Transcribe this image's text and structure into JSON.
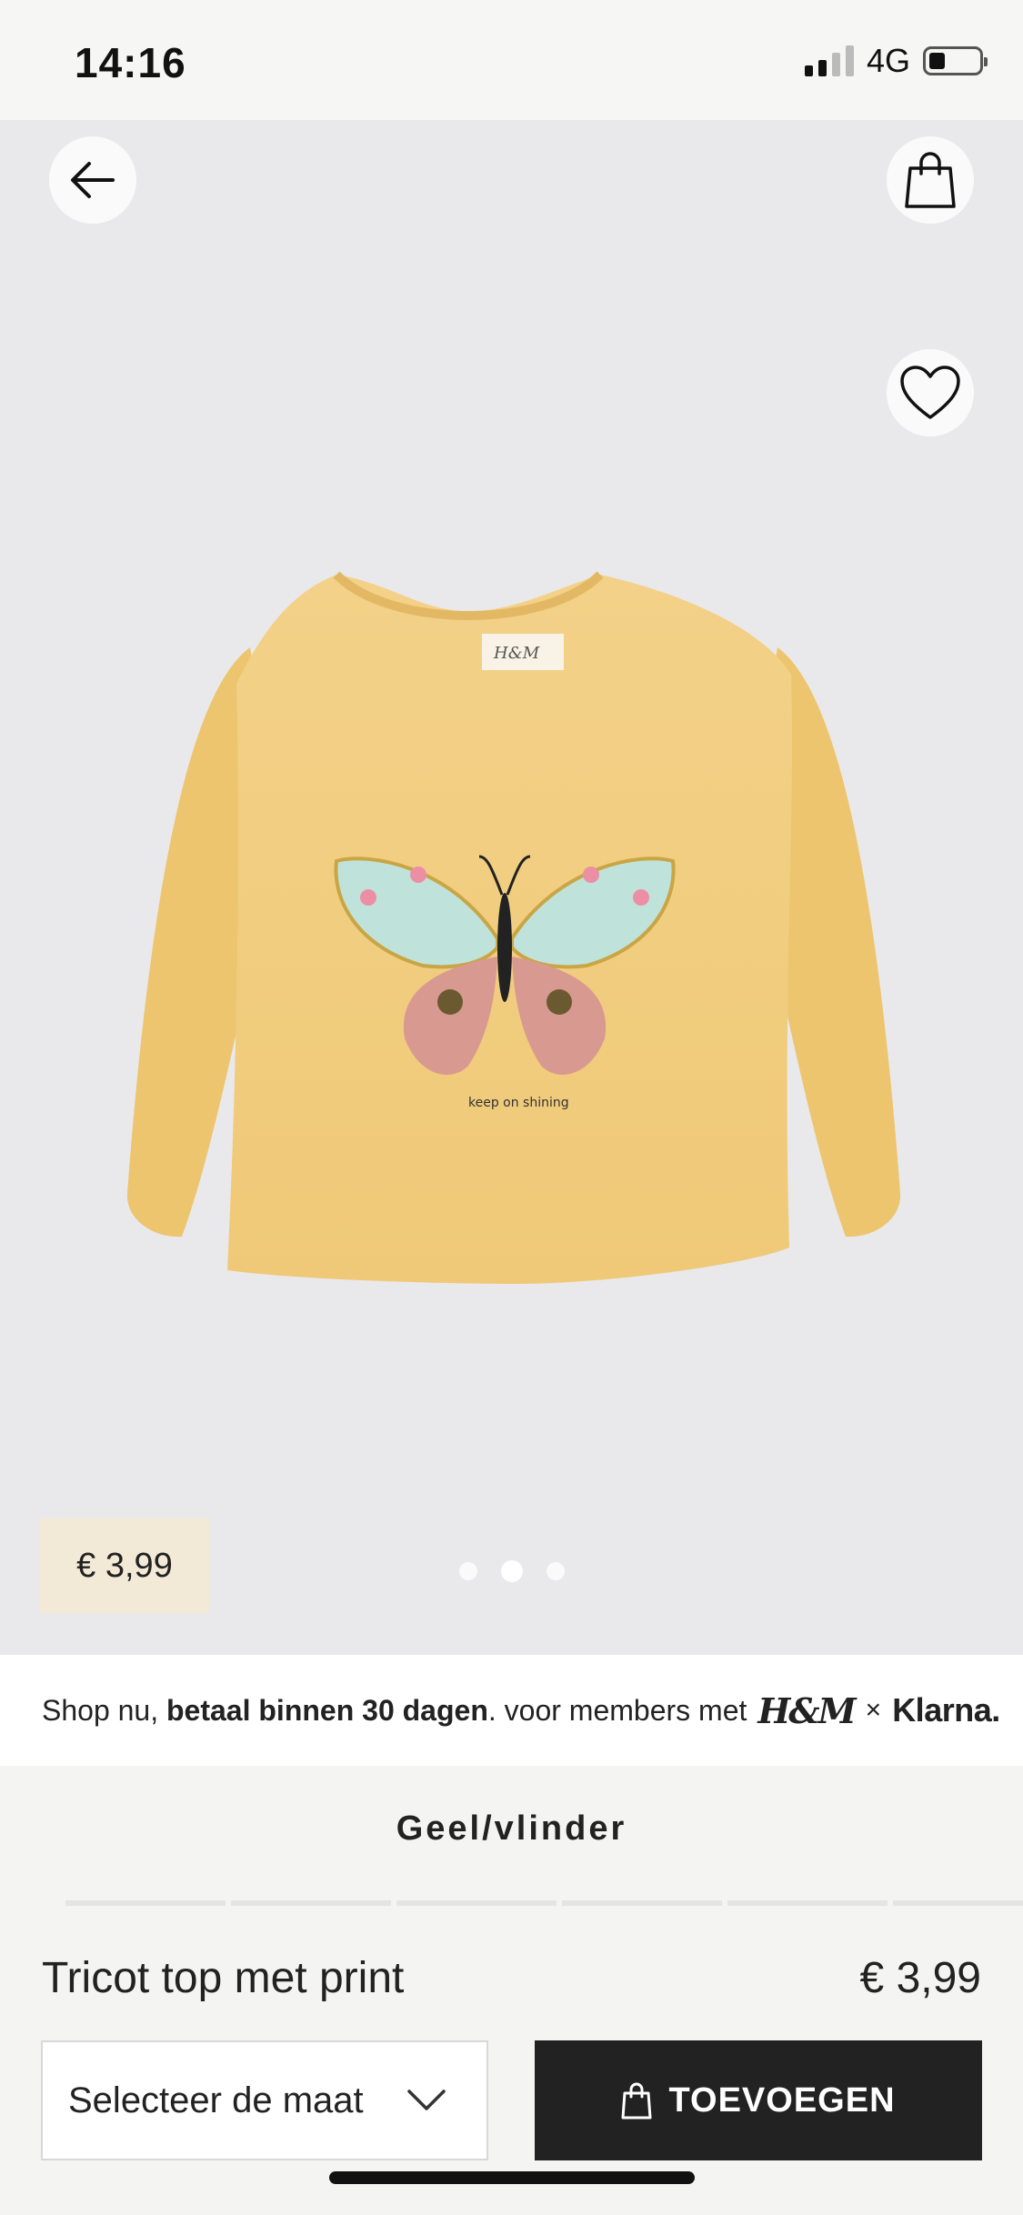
{
  "status": {
    "time": "14:16",
    "network": "4G",
    "signal_level": 0.5,
    "battery_level": 0.32
  },
  "nav": {
    "back_icon": "arrow-left-icon",
    "bag_icon": "shopping-bag-icon",
    "favorite_icon": "heart-outline-icon"
  },
  "hero": {
    "price": "€ 3,99",
    "shirt_color": "#f0cd7e",
    "print_text": "keep on shining",
    "carousel": {
      "count": 3,
      "active_index": 1
    }
  },
  "klarna": {
    "prefix": "Shop nu, ",
    "bold": "betaal binnen 30 dagen",
    "suffix": ". voor members met ",
    "hm": "H&M",
    "times": "×",
    "klarna": "Klarna."
  },
  "product": {
    "color_name": "Geel/vlinder",
    "title": "Tricot top met print",
    "price": "€ 3,99"
  },
  "actions": {
    "size_placeholder": "Selecteer de maat",
    "add_label": "TOEVOEGEN"
  },
  "colors": {
    "primary_button": "#222222",
    "price_tag_bg": "#f2ead6",
    "hero_bg": "#e9e9eb"
  }
}
